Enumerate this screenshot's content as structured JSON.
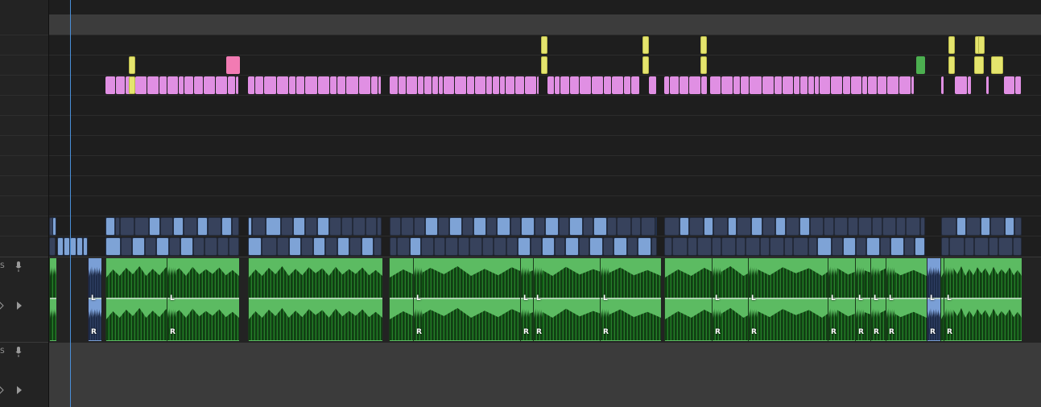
{
  "track_headers": {
    "a1": {
      "cut_label": "S",
      "mic_icon": "microphone-icon",
      "expand_icon": "play-triangle-icon"
    },
    "a2": {
      "cut_label": "S",
      "mic_icon": "microphone-icon",
      "expand_icon": "play-triangle-icon"
    }
  },
  "audio_track_a1": {
    "channel_labels": [
      {
        "l": "L",
        "r": "R"
      },
      {
        "l": "L",
        "r": "R"
      },
      {
        "l": "L",
        "r": "R"
      },
      {
        "l": "L",
        "r": "R"
      },
      {
        "l": "L",
        "r": "R"
      },
      {
        "l": "L",
        "r": "R"
      },
      {
        "l": "L",
        "r": "R"
      },
      {
        "l": "L",
        "r": "R"
      },
      {
        "l": "L",
        "r": "R"
      },
      {
        "l": "L",
        "r": "R"
      },
      {
        "l": "L",
        "r": "R"
      },
      {
        "l": "L",
        "r": "R"
      },
      {
        "l": "L",
        "r": "R"
      },
      {
        "l": "L",
        "r": "R"
      },
      {
        "l": "L",
        "r": "R"
      }
    ]
  },
  "colors": {
    "background": "#1e1e1e",
    "ruler_band": "#3c3c3c",
    "yellow_clip": "#e5e56d",
    "pink_clip": "#f27bb3",
    "magenta_clip": "#e08fe3",
    "green_clip": "#4caf50",
    "navy_clip": "#37425c",
    "lightblue_clip": "#7ea3d6",
    "audio_green": "#5cbb62",
    "audio_blue": "#7a9fd6",
    "playhead": "#4a8fd8"
  }
}
